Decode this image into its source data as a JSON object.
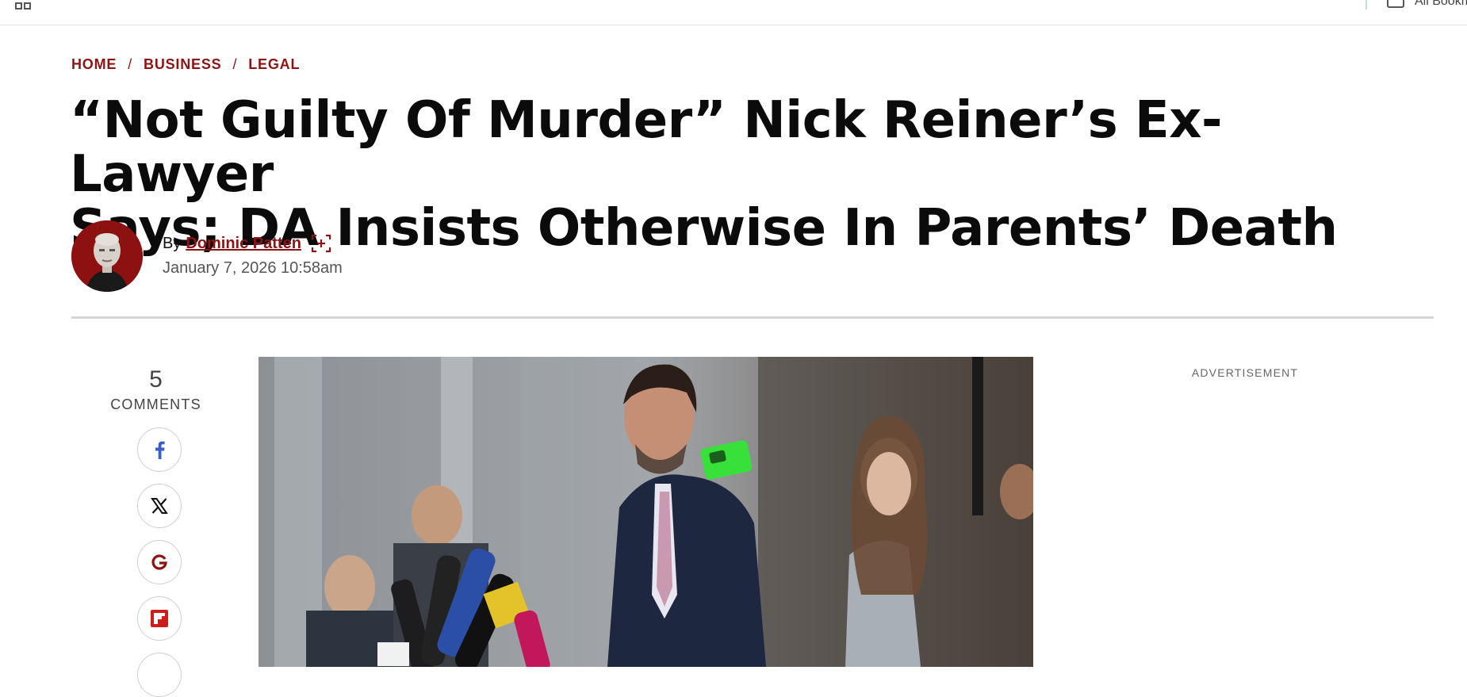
{
  "browser": {
    "bookmarks_label": "All Bookmarks",
    "apps_icon": "apps-grid-icon",
    "folder_icon": "folder-icon"
  },
  "breadcrumb": [
    {
      "label": "HOME"
    },
    {
      "label": "BUSINESS"
    },
    {
      "label": "LEGAL"
    }
  ],
  "breadcrumb_separator": "/",
  "article": {
    "headline_line1": "“Not Guilty Of Murder” Nick Reiner’s Ex-Lawyer",
    "headline_line2": "Says; DA Insists Otherwise In Parents’ Death",
    "byline_prefix": "By",
    "author": "Dominic Patten",
    "follow_icon": "follow-author-plus-icon",
    "date": "January 7, 2026 10:58am"
  },
  "engagement": {
    "comment_count": "5",
    "comment_label": "COMMENTS",
    "share_buttons": [
      {
        "name": "facebook",
        "icon": "facebook-icon"
      },
      {
        "name": "x",
        "icon": "x-icon"
      },
      {
        "name": "google",
        "icon": "google-icon"
      },
      {
        "name": "flipboard",
        "icon": "flipboard-icon"
      }
    ]
  },
  "sidebar": {
    "ad_label": "ADVERTISEMENT"
  },
  "colors": {
    "accent": "#8c1414",
    "rule": "#d4d4d4",
    "headline": "#0b0b0b"
  }
}
